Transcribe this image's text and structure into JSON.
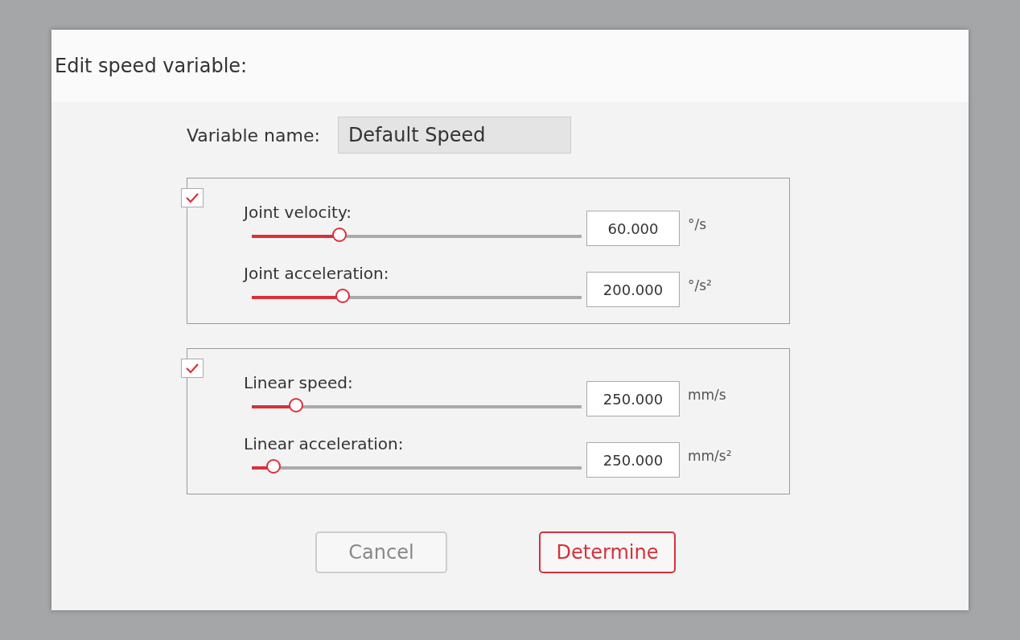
{
  "dialog": {
    "title": "Edit speed variable:",
    "variable_name": {
      "label": "Variable name:",
      "value": "Default Speed"
    },
    "groups": [
      {
        "checked": true,
        "rows": [
          {
            "label": "Joint velocity:",
            "level": 0.27,
            "value": "60.000",
            "unit": "°/s"
          },
          {
            "label": "Joint acceleration:",
            "level": 0.28,
            "value": "200.000",
            "unit": "°/s²"
          }
        ]
      },
      {
        "checked": true,
        "rows": [
          {
            "label": "Linear speed:",
            "level": 0.14,
            "value": "250.000",
            "unit": "mm/s"
          },
          {
            "label": "Linear acceleration:",
            "level": 0.07,
            "value": "250.000",
            "unit": "mm/s²"
          }
        ]
      }
    ],
    "buttons": [
      {
        "label": "Cancel",
        "kind": "secondary"
      },
      {
        "label": "Determine",
        "kind": "primary"
      }
    ]
  }
}
